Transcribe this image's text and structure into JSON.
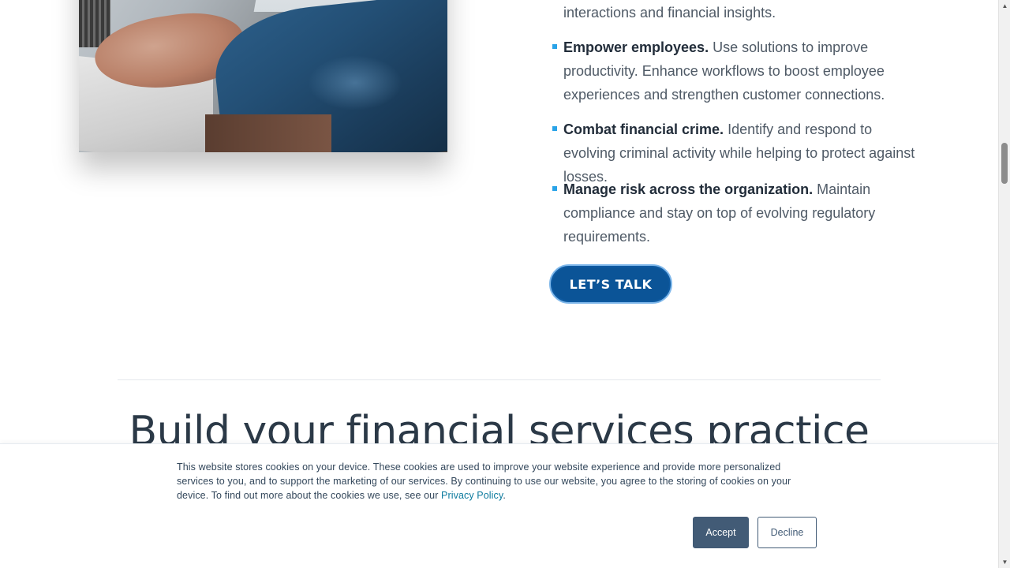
{
  "photo": {
    "alt": "person typing on laptop at desk"
  },
  "benefits": {
    "top_fragment": "interactions and financial insights.",
    "items": [
      {
        "title": "Empower employees.",
        "text": " Use solutions to improve productivity. Enhance workflows to boost employee experiences and strengthen customer connections."
      },
      {
        "title": "Combat financial crime.",
        "text": " Identify and respond to evolving criminal activity while helping to protect against losses."
      },
      {
        "title": "Manage risk across the organization.",
        "text": " Maintain compliance and stay on top of evolving regulatory requirements."
      }
    ],
    "cta_label": "LET’S TALK"
  },
  "section": {
    "title": "Build your financial services practice"
  },
  "cookie_banner": {
    "text": "This website stores cookies on your device. These cookies are used to improve your website experience and provide more personalized services to you, and to support the marketing of our services. By continuing to use our website, you agree to the storing of cookies on your device. To find out more about the cookies we use, see our ",
    "link_label": "Privacy Policy",
    "after_link": ".",
    "accept_label": "Accept",
    "decline_label": "Decline"
  },
  "scrollbar": {
    "up_icon": "▲",
    "down_icon": "▼"
  },
  "colors": {
    "accent": "#0b5497",
    "bullet": "#29a3e8",
    "accept_bg": "#425b76",
    "link": "#0b7a9e"
  }
}
